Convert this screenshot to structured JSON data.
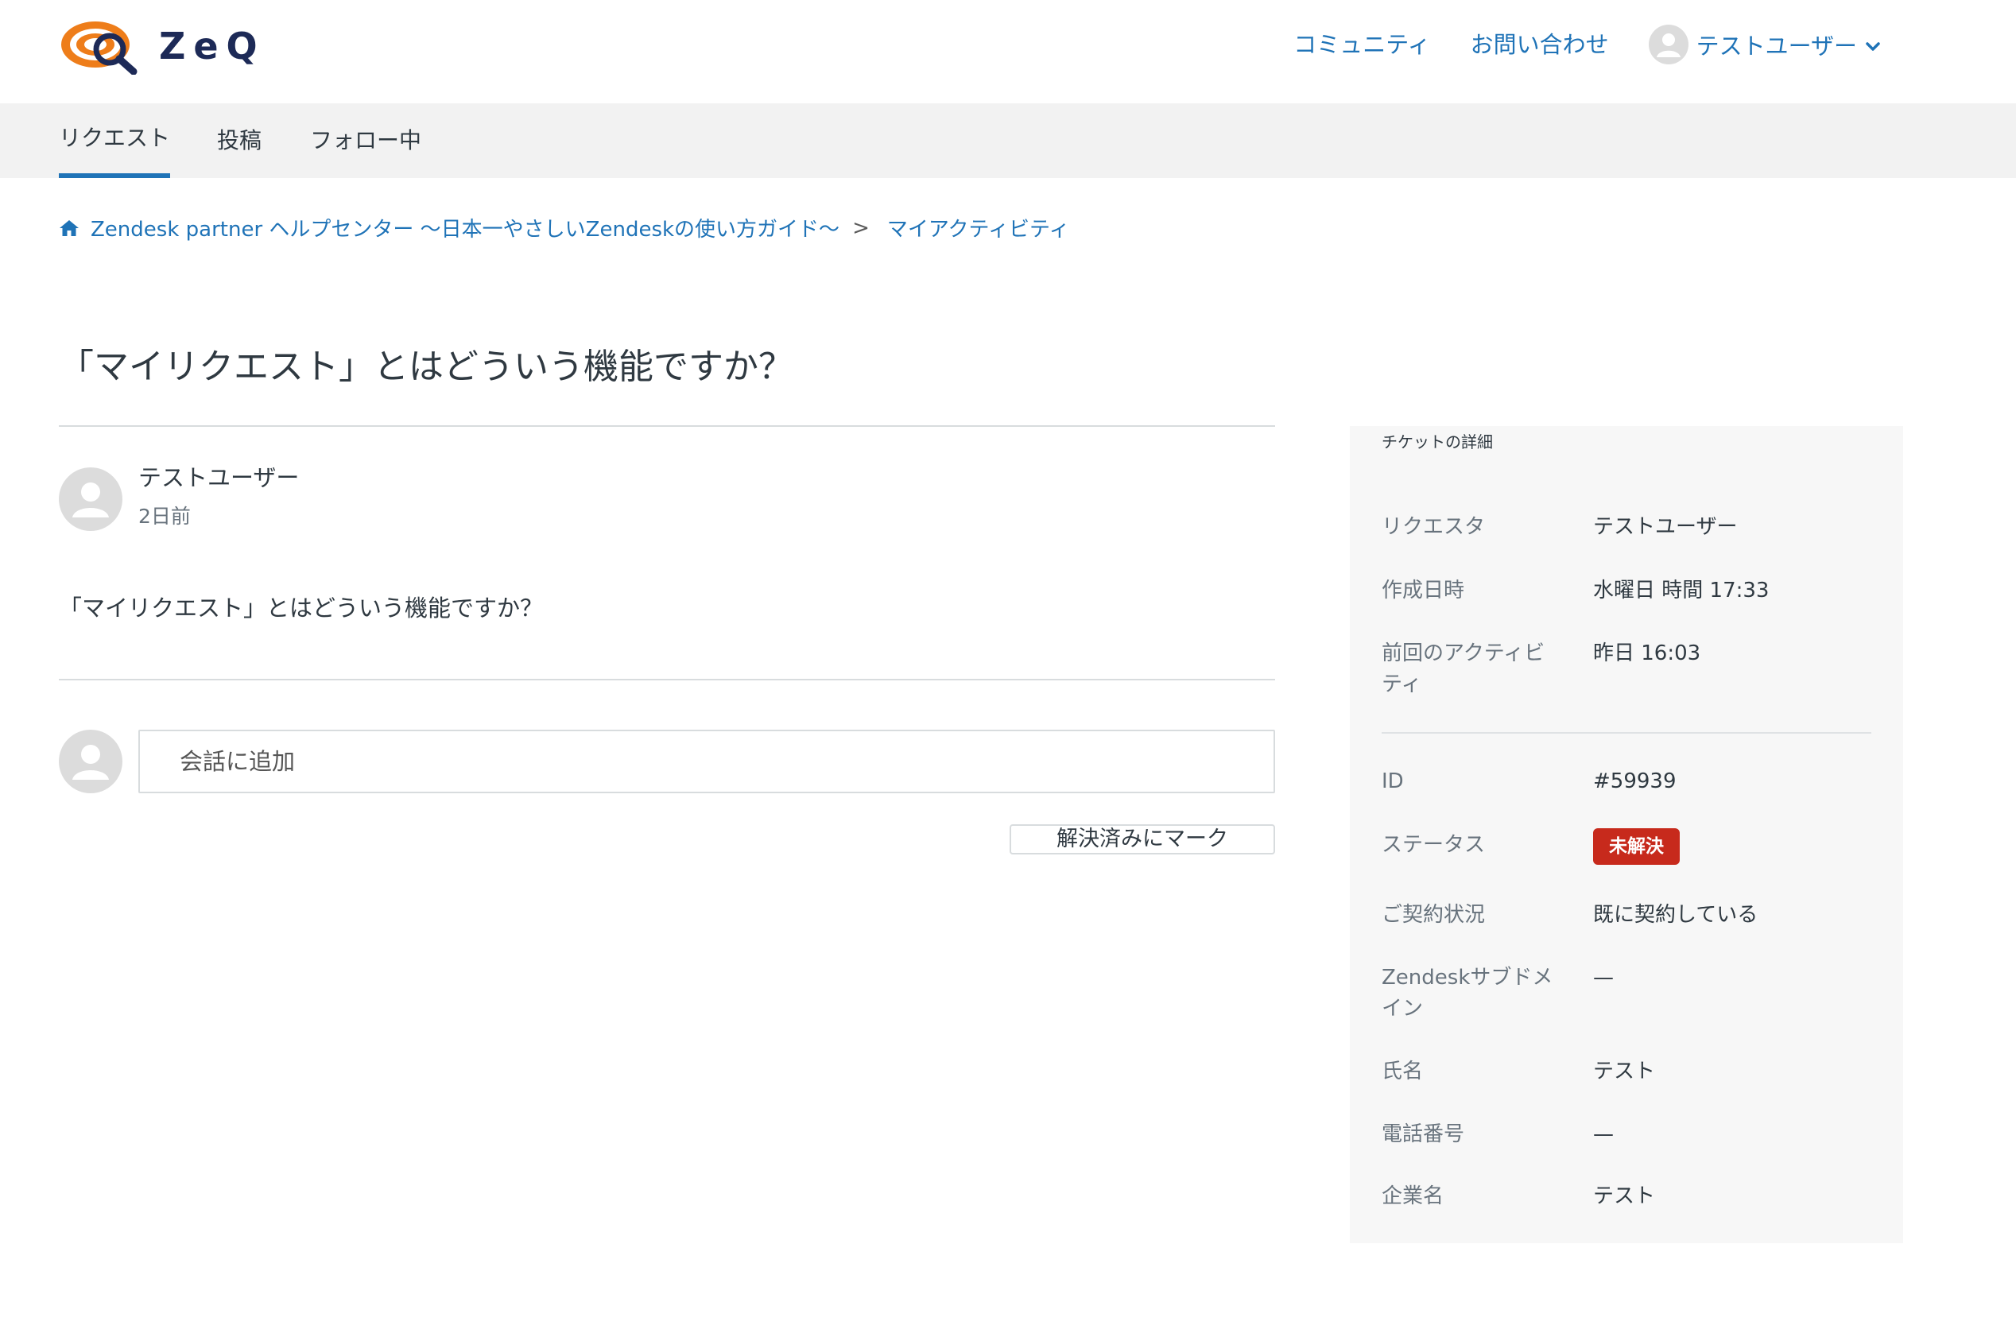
{
  "header": {
    "logo_text": "ZeQ",
    "links": [
      "コミュニティ",
      "お問い合わせ"
    ],
    "user_name": "テストユーザー"
  },
  "subnav": {
    "tabs": [
      "リクエスト",
      "投稿",
      "フォロー中"
    ],
    "active_tab": "リクエスト"
  },
  "breadcrumb": {
    "items": [
      "Zendesk partner ヘルプセンター 〜日本一やさしいZendeskの使い方ガイド〜",
      "マイアクティビティ"
    ],
    "separator": ">"
  },
  "request": {
    "title": "「マイリクエスト」とはどういう機能ですか？",
    "author": "テストユーザー",
    "time": "2日前",
    "body": "「マイリクエスト」とはどういう機能ですか？"
  },
  "reply": {
    "placeholder": "会話に追加",
    "solve_label": "解決済みにマーク"
  },
  "sidebar": {
    "title": "チケットの詳細",
    "requester": {
      "label": "リクエスタ",
      "value": "テストユーザー"
    },
    "created": {
      "label": "作成日時",
      "value": "水曜日 時間 17:33"
    },
    "last_activity": {
      "label": "前回のアクティビティ",
      "value": "昨日 16:03"
    },
    "id": {
      "label": "ID",
      "value": "#59939"
    },
    "status": {
      "label": "ステータス",
      "value": "未解決"
    },
    "contract": {
      "label": "ご契約状況",
      "value": "既に契約している"
    },
    "subdomain": {
      "label": "Zendeskサブドメイン",
      "value": "—"
    },
    "name": {
      "label": "氏名",
      "value": "テスト"
    },
    "phone": {
      "label": "電話番号",
      "value": "—"
    },
    "company": {
      "label": "企業名",
      "value": "テスト"
    }
  },
  "colors": {
    "link": "#1f73b7",
    "status_open": "#c72a1c",
    "subnav_bg": "#f2f2f2",
    "sidebar_bg": "#f7f7f7"
  },
  "icons": [
    "zeq-logo-icon",
    "user-avatar-icon",
    "chevron-down-icon",
    "home-icon"
  ]
}
